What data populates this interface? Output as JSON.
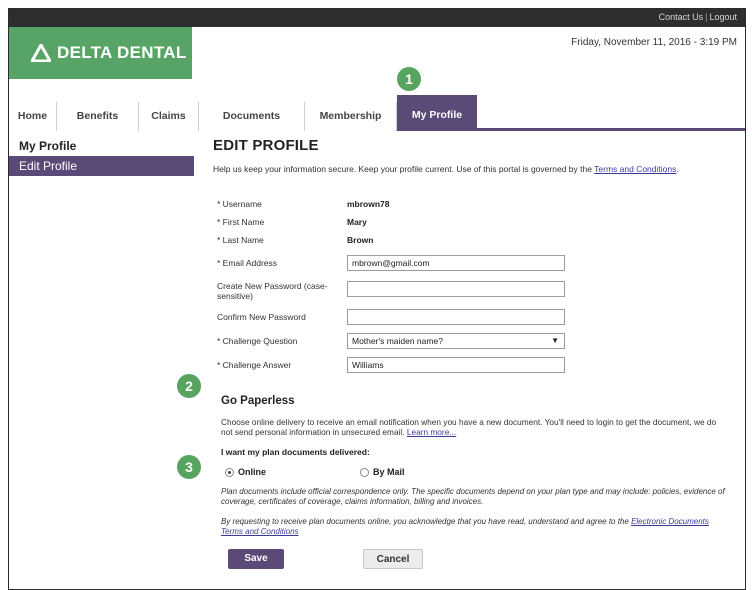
{
  "topbar": {
    "contact": "Contact Us",
    "logout": "Logout"
  },
  "header": {
    "logo_text": "DELTA DENTAL",
    "datetime": "Friday, November 11, 2016 - 3:19 PM"
  },
  "nav": {
    "tabs": [
      "Home",
      "Benefits",
      "Claims",
      "Documents",
      "Membership",
      "My Profile"
    ],
    "active": "My Profile"
  },
  "badges": [
    "1",
    "2",
    "3"
  ],
  "sidebar": {
    "title": "My Profile",
    "items": [
      "Edit Profile"
    ]
  },
  "page": {
    "title": "EDIT PROFILE",
    "intro": "Help us keep your information secure. Keep your profile current. Use of this portal is governed by the",
    "intro_link": "Terms and Conditions",
    "intro_end": "."
  },
  "form": {
    "username_label": "* Username",
    "username_value": "mbrown78",
    "first_name_label": "* First Name",
    "first_name_value": "Mary",
    "last_name_label": "* Last Name",
    "last_name_value": "Brown",
    "email_label": "* Email Address",
    "email_value": "mbrown@gmail.com",
    "new_password_label": "Create New Password (case-sensitive)",
    "new_password_value": "",
    "confirm_password_label": "Confirm New Password",
    "confirm_password_value": "",
    "challenge_q_label": "* Challenge Question",
    "challenge_q_value": "Mother's maiden name?",
    "challenge_a_label": "* Challenge Answer",
    "challenge_a_value": "Williams"
  },
  "paperless": {
    "title": "Go Paperless",
    "text": "Choose online delivery to receive an email notification when you have a new document. You'll need to login to get the document, we do not send personal information in unsecured email.",
    "learn_more": "Learn more...",
    "question": "I want my plan documents delivered:",
    "option_online": "Online",
    "option_mail": "By Mail",
    "selected": "Online",
    "note1": "Plan documents include official correspondence only. The specific documents depend on your plan type and may include: policies, evidence of coverage, certificates of coverage, claims information, billing and invoices.",
    "note2": "By requesting to receive plan documents online, you acknowledge that you have read, understand and agree to the",
    "note2_link": "Electronic Documents Terms and Conditions"
  },
  "buttons": {
    "save": "Save",
    "cancel": "Cancel"
  },
  "colors": {
    "brand_green": "#58a466",
    "brand_purple": "#5b4a78",
    "badge_green": "#57a360"
  }
}
